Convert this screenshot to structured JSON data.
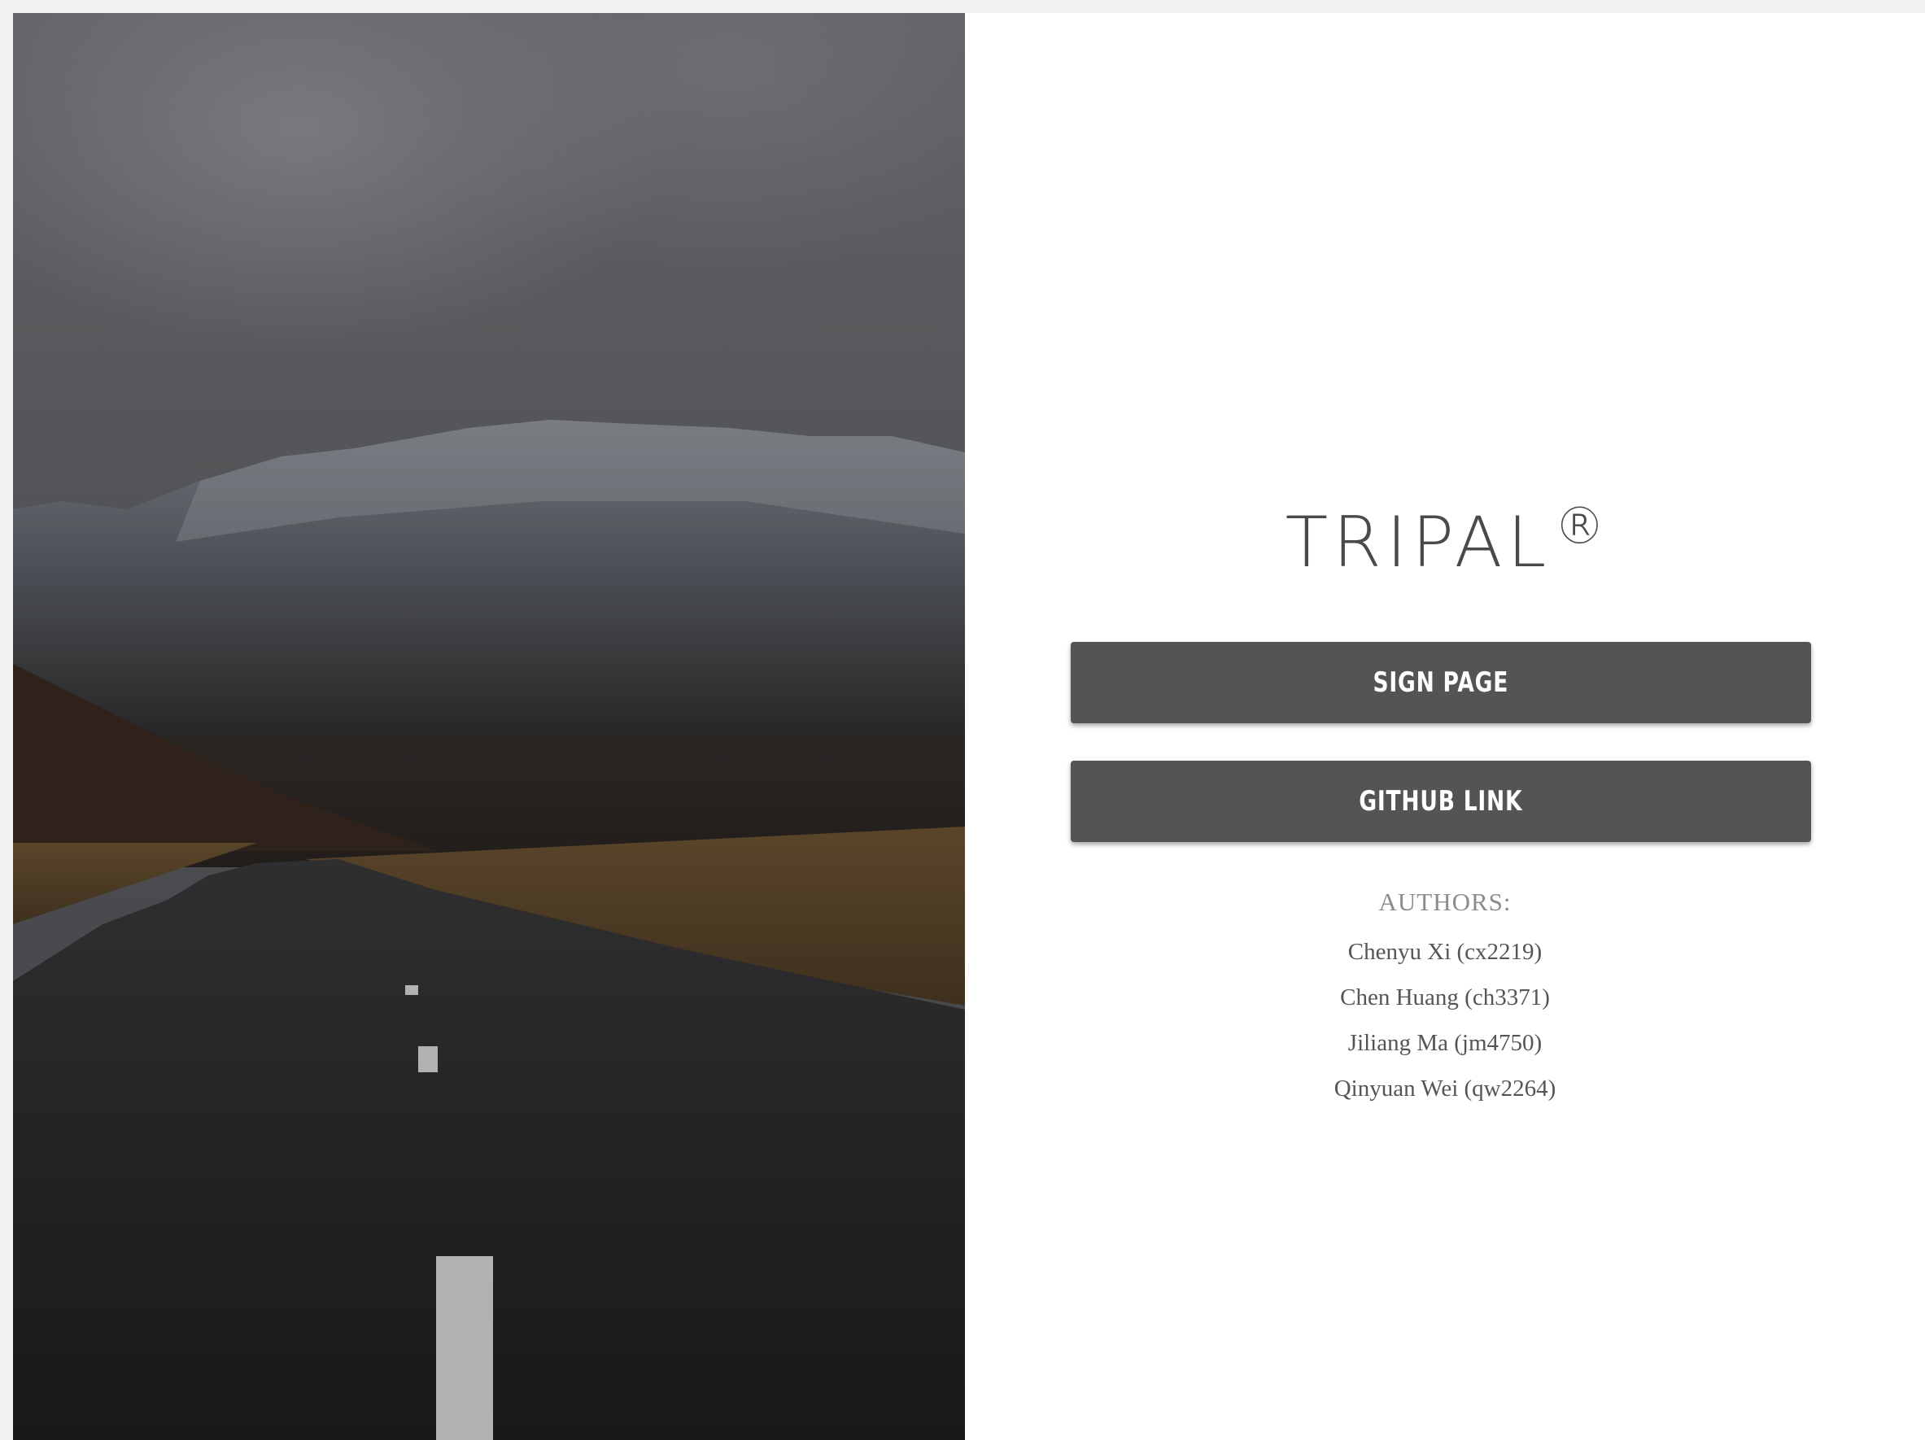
{
  "brand": {
    "name": "TRIPAL",
    "mark": "®"
  },
  "buttons": {
    "sign": "SIGN PAGE",
    "github": "GITHUB LINK"
  },
  "authors": {
    "heading": "AUTHORS:",
    "list": [
      "Chenyu Xi (cx2219)",
      "Chen Huang (ch3371)",
      "Jiliang Ma (jm4750)",
      "Qinyuan Wei (qw2264)"
    ]
  },
  "colors": {
    "button": "#545454",
    "logo": "#4a4a4a",
    "text": "#555555",
    "heading": "#8c8c8c"
  }
}
